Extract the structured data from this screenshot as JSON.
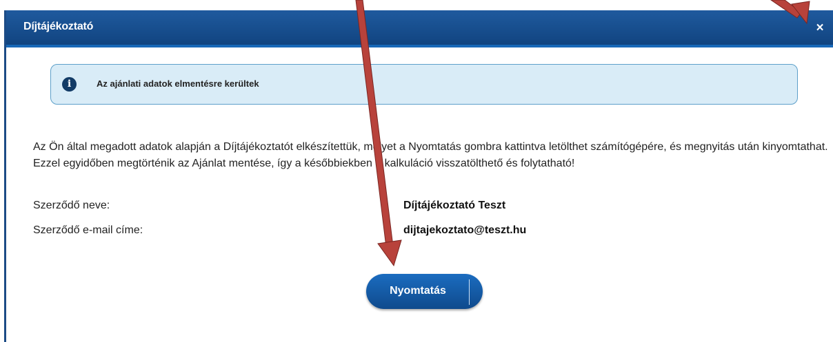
{
  "dialog": {
    "title": "Díjtájékoztató",
    "close_glyph": "×",
    "close_icon": "close-icon"
  },
  "notice": {
    "icon": "info-icon",
    "icon_glyph": "i",
    "text": "Az ajánlati adatok elmentésre kerültek"
  },
  "body": {
    "paragraph": "Az Ön által megadott adatok alapján a Díjtájékoztatót elkészítettük, melyet a Nyomtatás gombra kattintva letölthet számítógépére, és megnyitás után kinyomtathat. Ezzel egyidőben megtörténik az Ajánlat mentése, így a későbbiekben a kalkuláció visszatölthető és folytatható!"
  },
  "fields": [
    {
      "label": "Szerződő neve:",
      "value": "Díjtájékoztató Teszt"
    },
    {
      "label": "Szerződő e-mail címe:",
      "value": "dijtajekoztato@teszt.hu"
    }
  ],
  "actions": {
    "print_label": "Nyomtatás"
  },
  "colors": {
    "titlebar": "#114480",
    "notice_bg": "#d9ecf7",
    "notice_border": "#5c9fc9",
    "button": "#0f4a8d",
    "annotation_arrow": "#b8423b"
  }
}
